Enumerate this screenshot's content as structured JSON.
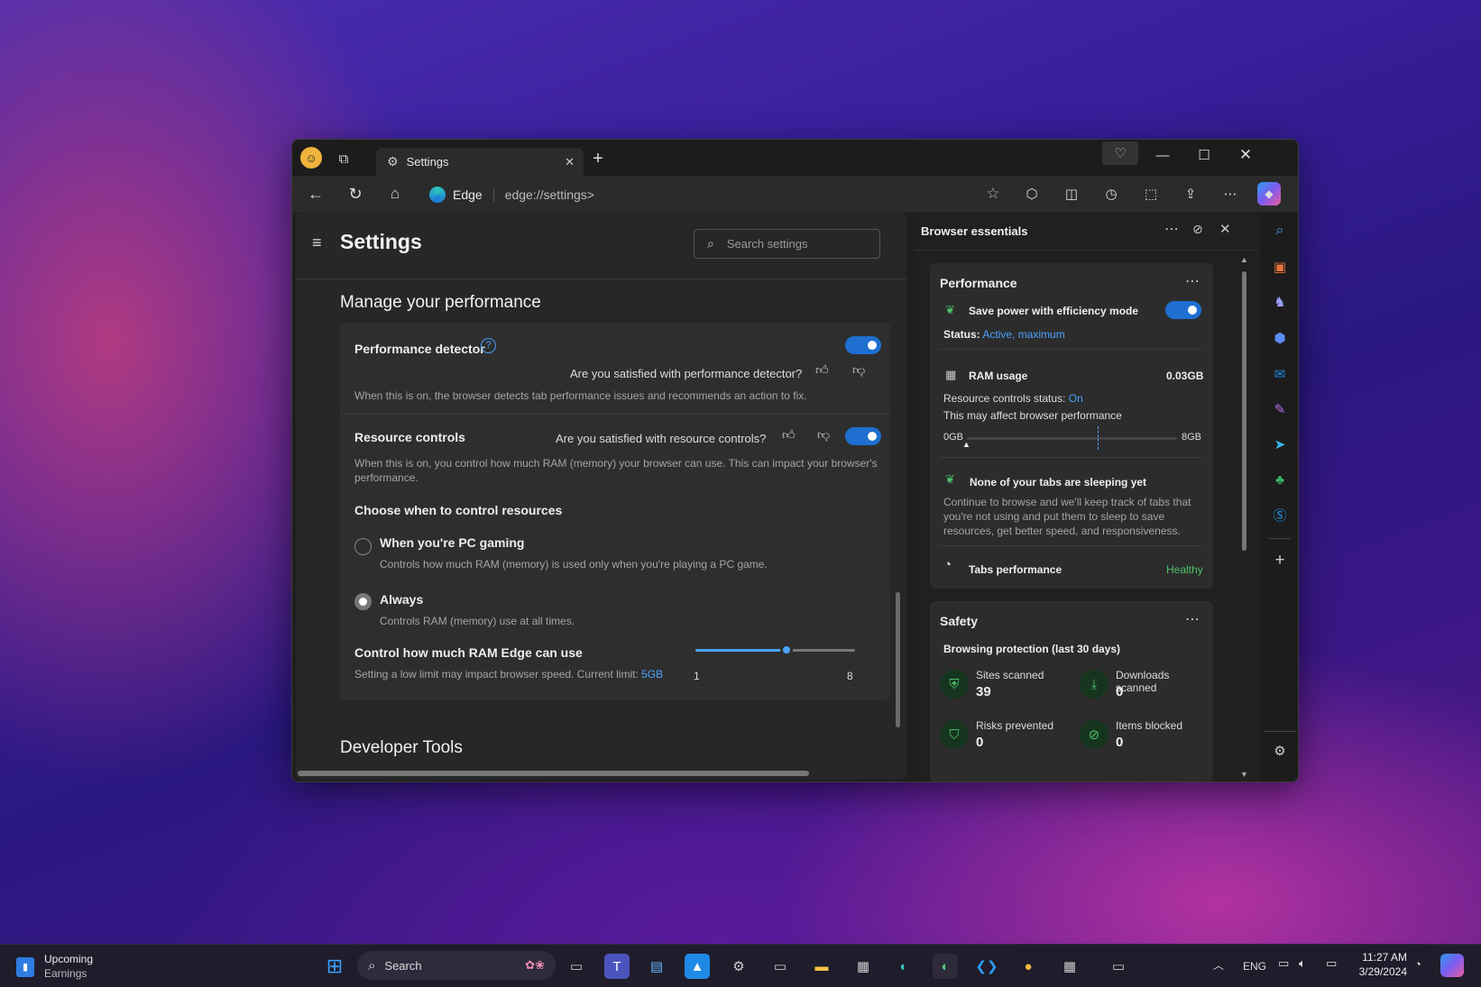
{
  "window": {
    "tab_title": "Settings",
    "address_brand": "Edge",
    "address_url": "edge://settings>"
  },
  "settings": {
    "title": "Settings",
    "search_placeholder": "Search settings",
    "section_title": "Manage your performance",
    "perf_detector": {
      "label": "Performance detector",
      "feedback": "Are you satisfied with performance detector?",
      "desc": "When this is on, the browser detects tab performance issues and recommends an action to fix."
    },
    "resource_controls": {
      "label": "Resource controls",
      "feedback": "Are you satisfied with resource controls?",
      "desc": "When this is on, you control how much RAM (memory) your browser can use. This can impact your browser's performance."
    },
    "choose_title": "Choose when to control resources",
    "option_gaming": {
      "label": "When you're PC gaming",
      "desc": "Controls how much RAM (memory) is used only when you're playing a PC game."
    },
    "option_always": {
      "label": "Always",
      "desc": "Controls RAM (memory) use at all times."
    },
    "ram_limit": {
      "label": "Control how much RAM Edge can use",
      "desc": "Setting a low limit may impact browser speed. Current limit: ",
      "current": "5GB",
      "min": "1",
      "max": "8",
      "value": 5
    },
    "next_section": "Developer Tools"
  },
  "essentials": {
    "title": "Browser essentials",
    "performance": {
      "title": "Performance",
      "efficiency_label": "Save power with efficiency mode",
      "status_label": "Status:",
      "status_value": "Active, maximum",
      "ram_label": "RAM usage",
      "ram_value": "0.03GB",
      "resource_status_label": "Resource controls status:",
      "resource_status_value": "On",
      "affect_text": "This may affect browser performance",
      "bar_min": "0GB",
      "bar_max": "8GB",
      "sleeping_title": "None of your tabs are sleeping yet",
      "sleeping_desc": "Continue to browse and we'll keep track of tabs that you're not using and put them to sleep to save resources, get better speed, and responsiveness.",
      "tabs_perf_label": "Tabs performance",
      "tabs_perf_value": "Healthy"
    },
    "safety": {
      "title": "Safety",
      "subtitle": "Browsing protection (last 30 days)",
      "stats": [
        {
          "label": "Sites scanned",
          "value": "39"
        },
        {
          "label": "Downloads scanned",
          "value": "0"
        },
        {
          "label": "Risks prevented",
          "value": "0"
        },
        {
          "label": "Items blocked",
          "value": "0"
        }
      ]
    }
  },
  "taskbar": {
    "widget_title": "Upcoming",
    "widget_sub": "Earnings",
    "search_label": "Search",
    "lang": "ENG",
    "time": "11:27 AM",
    "date": "3/29/2024"
  },
  "colors": {
    "accent": "#1e6fd0",
    "link": "#4aa3ff",
    "healthy": "#4cc26a"
  }
}
